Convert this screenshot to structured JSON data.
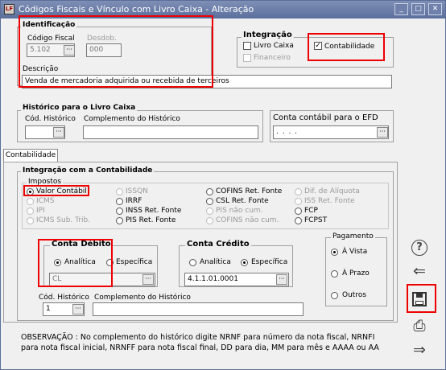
{
  "window": {
    "title": "Códigos Fiscais e Vínculo com Livro Caixa - Alteração",
    "icon_text": "LF"
  },
  "identificacao": {
    "group_label": "Identificação",
    "codigo_fiscal_label": "Código Fiscal",
    "codigo_fiscal_value": "5.102",
    "desdob_label": "Desdob.",
    "desdob_value": "000",
    "descricao_label": "Descrição",
    "descricao_value": "Venda de mercadoria adquirida ou recebida de terceiros"
  },
  "integracao": {
    "group_label": "Integração",
    "livro_caixa": "Livro Caixa",
    "financeiro": "Financeiro",
    "contabilidade": "Contabilidade",
    "contabilidade_check": "✓"
  },
  "historico": {
    "group_label": "Histórico para o Livro Caixa",
    "cod_label": "Cód. Histórico",
    "compl_label": "Complemento do Histórico"
  },
  "efd": {
    "label": "Conta contábil para o EFD",
    "value": ". . . ."
  },
  "tab": {
    "label": "Contabilidade"
  },
  "integracao_contab": {
    "group_label": "Integração com a Contabilidade",
    "impostos_label": "Impostos",
    "impostos": [
      "Valor Contábil",
      "ICMS",
      "IPI",
      "ICMS Sub. Trib.",
      "ISSQN",
      "IRRF",
      "INSS Ret. Fonte",
      "PIS Ret. Fonte",
      "COFINS Ret. Fonte",
      "CSL Ret. Fonte",
      "PIS não cum.",
      "COFINS não cum.",
      "Dif. de Alíquota",
      "ISS Ret. Fonte",
      "FCP",
      "FCPST"
    ]
  },
  "conta_debito": {
    "label": "Conta Débito",
    "analitica": "Analítica",
    "especifica": "Específica",
    "value": "CL"
  },
  "conta_credito": {
    "label": "Conta Crédito",
    "analitica": "Analítica",
    "especifica": "Específica",
    "value": "4.1.1.01.0001"
  },
  "pagamento": {
    "label": "Pagamento",
    "a_vista": "À Vista",
    "a_prazo": "À Prazo",
    "outros": "Outros"
  },
  "historico2": {
    "cod_label": "Cód. Histórico",
    "cod_value": "1",
    "compl_label": "Complemento do Histórico"
  },
  "observacao": "OBSERVAÇÃO : No complemento do histórico digite NRNF para número da nota fiscal, NRNFI\npara nota fiscal inicial, NRNFF para nota fiscal final, DD para dia, MM para mês e AAAA ou AA",
  "sidebar": {
    "help": "?",
    "back": "⇐",
    "save": "💾",
    "print": "⎙",
    "next": "⇒"
  },
  "common": {
    "ellipsis": "···",
    "dropdown": "▾",
    "min": "_",
    "max": "□",
    "close": "✕"
  }
}
